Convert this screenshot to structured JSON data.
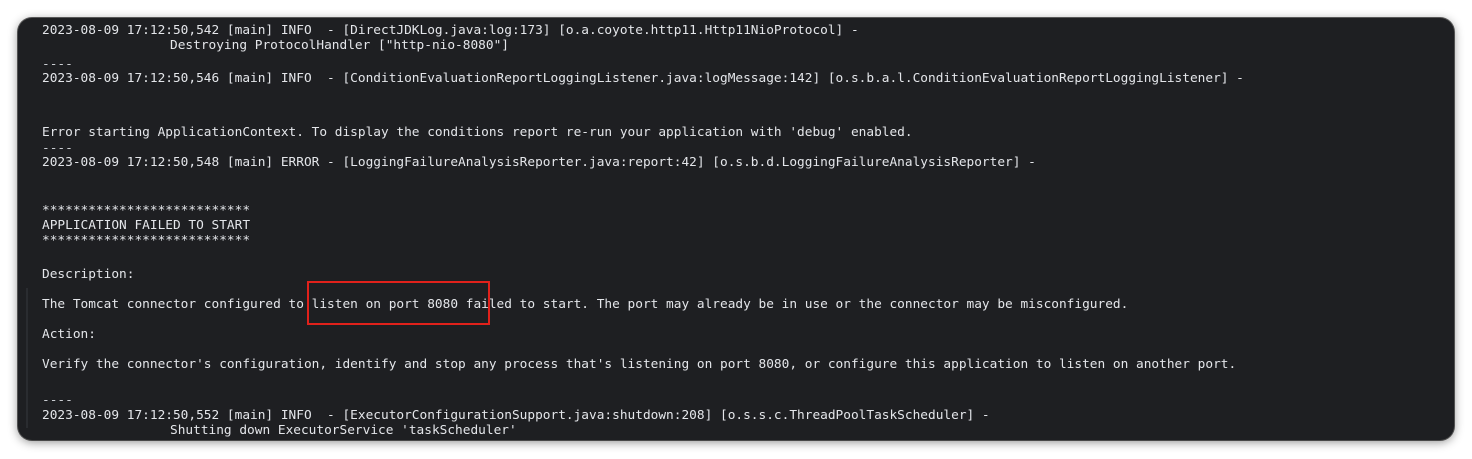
{
  "log_lines": {
    "l1": "2023-08-09 17:12:50,542 [main] INFO  - [DirectJDKLog.java:log:173] [o.a.coyote.http11.Http11NioProtocol] -",
    "l2": "Destroying ProtocolHandler [\"http-nio-8080\"]",
    "sep1": "----",
    "l3": "2023-08-09 17:12:50,546 [main] INFO  - [ConditionEvaluationReportLoggingListener.java:logMessage:142] [o.s.b.a.l.ConditionEvaluationReportLoggingListener] -",
    "l4": "Error starting ApplicationContext. To display the conditions report re-run your application with 'debug' enabled.",
    "sep2": "----",
    "l5": "2023-08-09 17:12:50,548 [main] ERROR - [LoggingFailureAnalysisReporter.java:report:42] [o.s.b.d.LoggingFailureAnalysisReporter] -",
    "stars1": "***************************",
    "banner": "APPLICATION FAILED TO START",
    "stars2": "***************************",
    "description_label": "Description:",
    "description_text": "The Tomcat connector configured to listen on port 8080 failed to start. The port may already be in use or the connector may be misconfigured.",
    "action_label": "Action:",
    "action_text": "Verify the connector's configuration, identify and stop any process that's listening on port 8080, or configure this application to listen on another port.",
    "sep3": "----",
    "l6": "2023-08-09 17:12:50,552 [main] INFO  - [ExecutorConfigurationSupport.java:shutdown:208] [o.s.s.c.ThreadPoolTaskScheduler] -",
    "l7": "Shutting down ExecutorService 'taskScheduler'"
  },
  "colors": {
    "background": "#1e1f22",
    "text": "#e4e6ea",
    "highlight": "#e0211b"
  }
}
